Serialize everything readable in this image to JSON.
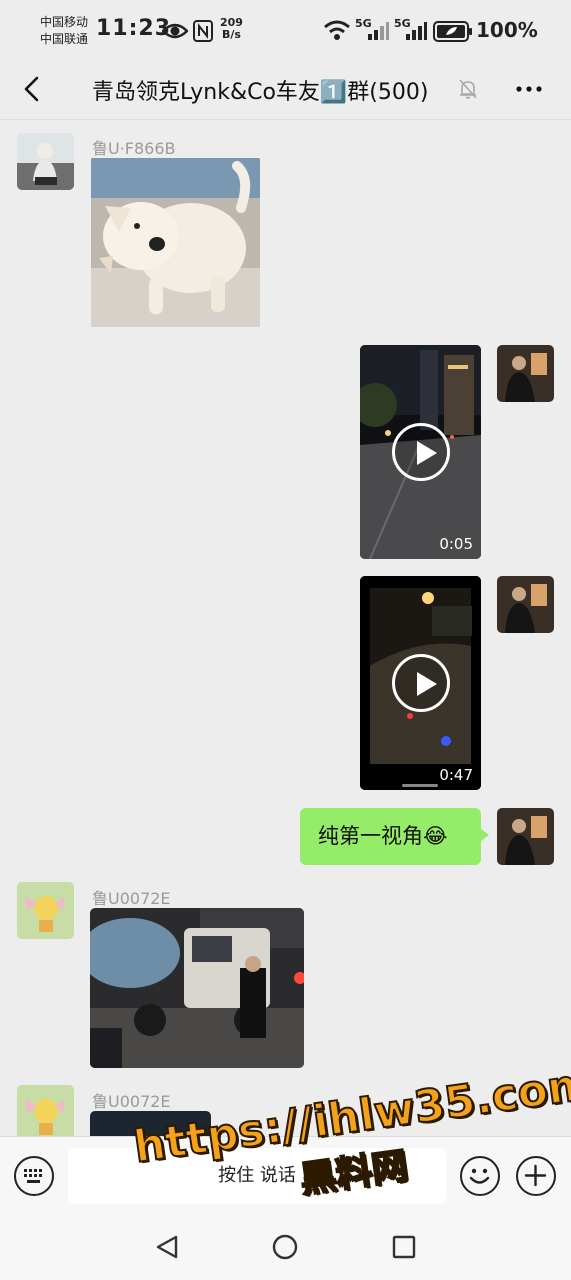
{
  "status_bar": {
    "carrier_1": "中国移动",
    "carrier_2": "中国联通",
    "time": "11:23",
    "net_speed_value": "209",
    "net_speed_unit": "B/s",
    "signal_1_label": "5G",
    "signal_2_label": "5G",
    "battery_percent": "100%"
  },
  "title_bar": {
    "title": "青岛领克Lynk&Co车友1️⃣群(500)",
    "back_icon": "chevron-left-icon",
    "mute_icon": "bell-muted-icon",
    "more_icon": "more-dots-icon"
  },
  "messages": [
    {
      "type": "image",
      "side": "left",
      "sender": "鲁U·F866B",
      "content": "puppy sticker"
    },
    {
      "type": "video",
      "side": "right",
      "duration": "0:05"
    },
    {
      "type": "video",
      "side": "right",
      "duration": "0:47"
    },
    {
      "type": "text",
      "side": "right",
      "text": "纯第一视角😂"
    },
    {
      "type": "image",
      "side": "left",
      "sender": "鲁U0072E",
      "content": "street scene photo"
    },
    {
      "type": "image",
      "side": "left",
      "sender": "鲁U0072E",
      "content": "dark photo"
    }
  ],
  "input_bar": {
    "voice_label": "按住 说话",
    "keyboard_icon": "keyboard-icon",
    "emoji_icon": "emoji-icon",
    "plus_icon": "plus-icon"
  },
  "nav_bar": {
    "back_icon": "nav-back-icon",
    "home_icon": "nav-home-icon",
    "recents_icon": "nav-recents-icon"
  },
  "watermark": {
    "url": "https://ihlw35.com",
    "name": "黑料网"
  },
  "colors": {
    "background": "#ededed",
    "bubble_green": "#95ec69",
    "watermark_orange": "#f4a21c"
  }
}
